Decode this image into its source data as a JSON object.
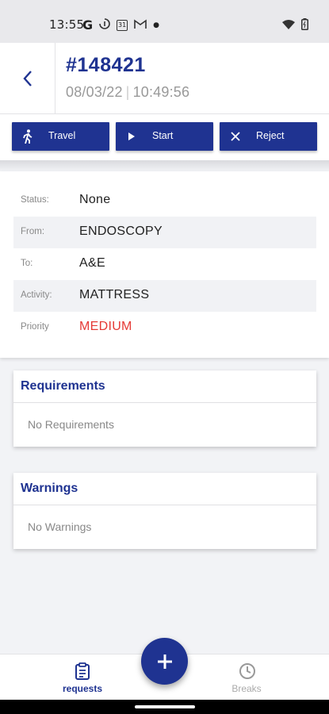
{
  "status_bar": {
    "time": "13:55",
    "icons": [
      "google-icon",
      "sync-icon",
      "calendar-icon",
      "gmail-icon",
      "dot-icon",
      "wifi-icon",
      "battery-icon"
    ],
    "calendar_day": "31"
  },
  "header": {
    "request_id": "#148421",
    "date": "08/03/22",
    "time": "10:49:56"
  },
  "actions": [
    {
      "label": "Travel",
      "icon": "walking-person-icon"
    },
    {
      "label": "Start",
      "icon": "play-icon"
    },
    {
      "label": "Reject",
      "icon": "close-icon"
    }
  ],
  "details": [
    {
      "label": "Status:",
      "value": "None"
    },
    {
      "label": "From:",
      "value": "ENDOSCOPY"
    },
    {
      "label": "To:",
      "value": "A&E"
    },
    {
      "label": "Activity:",
      "value": "MATTRESS"
    },
    {
      "label": "Priority",
      "value": "MEDIUM"
    }
  ],
  "requirements": {
    "title": "Requirements",
    "empty_text": "No Requirements"
  },
  "warnings": {
    "title": "Warnings",
    "empty_text": "No Warnings"
  },
  "bottom_nav": {
    "requests_label": "requests",
    "breaks_label": "Breaks",
    "fab_icon": "plus-icon"
  },
  "colors": {
    "primary": "#1f3391",
    "priority_medium": "#e53935"
  }
}
